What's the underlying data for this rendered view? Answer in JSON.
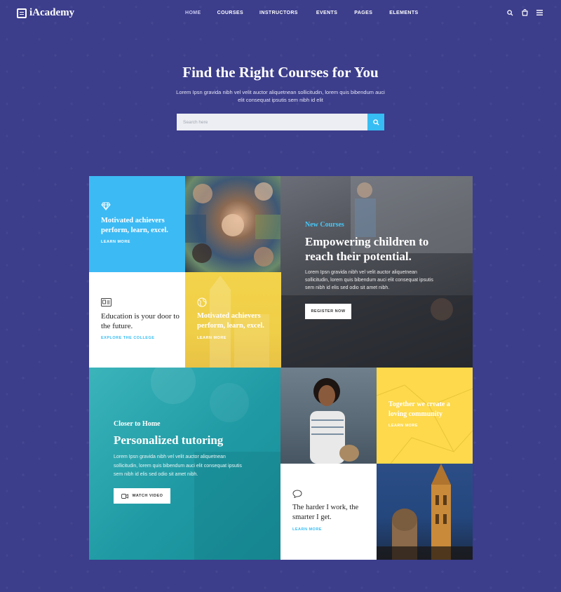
{
  "brand": {
    "name": "iAcademy"
  },
  "nav": [
    "HOME",
    "COURSES",
    "INSTRUCTORS",
    "EVENTS",
    "PAGES",
    "ELEMENTS"
  ],
  "hero": {
    "title": "Find the Right Courses for You",
    "subtitle": "Lorem Ipsn gravida nibh vel velit auctor aliquetnean sollicitudin, lorem quis bibendum auci elit consequat ipsutis sem nibh id elit",
    "search_placeholder": "Search here"
  },
  "tiles": {
    "blue": {
      "title": "Motivated achievers perform, learn, excel.",
      "link": "LEARN MORE"
    },
    "college": {
      "title": "Education is your door to the future.",
      "link": "EXPLORE THE COLLEGE"
    },
    "yellow1": {
      "title": "Motivated achievers perform, learn, excel.",
      "link": "LEARN MORE"
    },
    "empower": {
      "kicker": "New Courses",
      "title": "Empowering children to reach their potential.",
      "text": "Lorem Ipsn gravida nibh vel velit auctor aliquetnean sollicitudin, lorem quis bibendum auci elit consequat ipsutis sem nibh id elis sed odio sit amet nibh.",
      "button": "REGISTER NOW"
    },
    "tutoring": {
      "kicker": "Closer to Home",
      "title": "Personalized tutoring",
      "text": "Lorem Ipsn gravida nibh vel velit auctor aliquetnean sollicitudin, lorem quis bibendum auci elit consequat ipsutis sem nibh id elis sed odio sit amet nibh.",
      "button": "WATCH VIDEO"
    },
    "community": {
      "title": "Together we create a loving community",
      "link": "LEARN MORE"
    },
    "quote": {
      "title": "The harder I work, the smarter I get.",
      "link": "LEARN MORE"
    }
  },
  "colors": {
    "background": "#3c3d8b",
    "accent": "#36bdf3",
    "yellow": "#fdd94b",
    "teal": "#1f9aa4"
  }
}
